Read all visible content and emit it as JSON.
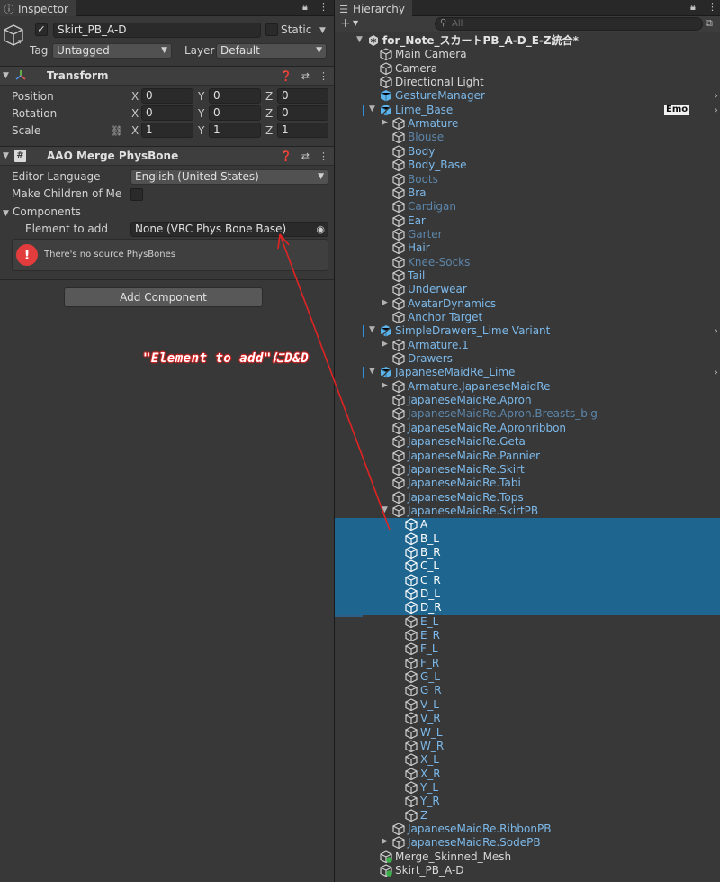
{
  "inspector": {
    "tab_label": "Inspector",
    "object_name": "Skirt_PB_A-D",
    "static_label": "Static",
    "tag_label": "Tag",
    "tag_value": "Untagged",
    "layer_label": "Layer",
    "layer_value": "Default",
    "transform": {
      "title": "Transform",
      "rows": [
        {
          "label": "Position",
          "x": "0",
          "y": "0",
          "z": "0"
        },
        {
          "label": "Rotation",
          "x": "0",
          "y": "0",
          "z": "0"
        },
        {
          "label": "Scale",
          "x": "1",
          "y": "1",
          "z": "1"
        }
      ],
      "axis_x": "X",
      "axis_y": "Y",
      "axis_z": "Z"
    },
    "merge": {
      "title": "AAO Merge PhysBone",
      "editor_language_label": "Editor Language",
      "editor_language_value": "English (United States)",
      "make_children_label": "Make Children of Me",
      "components_label": "Components",
      "element_label": "Element to add",
      "element_value": "None (VRC Phys Bone Base)",
      "error_message": "There's no source PhysBones"
    },
    "add_component": "Add Component"
  },
  "annotation_text": "\"Element to add\"にD&D",
  "hierarchy": {
    "tab_label": "Hierarchy",
    "search_placeholder": "All",
    "emo_badge": "Emo",
    "rows": [
      {
        "label": "for_Note_スカートPB_A-D_E-Z統合*",
        "color": "bold",
        "depth": 0,
        "toggle": "down",
        "icon": "scene"
      },
      {
        "label": "Main Camera",
        "color": "white",
        "depth": 1,
        "toggle": "",
        "icon": "cube"
      },
      {
        "label": "Camera",
        "color": "white",
        "depth": 1,
        "toggle": "",
        "icon": "cube"
      },
      {
        "label": "Directional Light",
        "color": "white",
        "depth": 1,
        "toggle": "",
        "icon": "cube"
      },
      {
        "label": "GestureManager",
        "color": "blue",
        "depth": 1,
        "toggle": "",
        "icon": "prefab",
        "chevron": true
      },
      {
        "label": "Lime_Base",
        "color": "blue",
        "depth": 1,
        "toggle": "down",
        "icon": "prefab-var",
        "chevron": true,
        "mark": true,
        "emo": true
      },
      {
        "label": "Armature",
        "color": "blue",
        "depth": 2,
        "toggle": "right",
        "icon": "cube"
      },
      {
        "label": "Blouse",
        "color": "dim",
        "depth": 2,
        "toggle": "",
        "icon": "cube"
      },
      {
        "label": "Body",
        "color": "blue",
        "depth": 2,
        "toggle": "",
        "icon": "cube"
      },
      {
        "label": "Body_Base",
        "color": "blue",
        "depth": 2,
        "toggle": "",
        "icon": "cube"
      },
      {
        "label": "Boots",
        "color": "dim",
        "depth": 2,
        "toggle": "",
        "icon": "cube"
      },
      {
        "label": "Bra",
        "color": "blue",
        "depth": 2,
        "toggle": "",
        "icon": "cube"
      },
      {
        "label": "Cardigan",
        "color": "dim",
        "depth": 2,
        "toggle": "",
        "icon": "cube"
      },
      {
        "label": "Ear",
        "color": "blue",
        "depth": 2,
        "toggle": "",
        "icon": "cube"
      },
      {
        "label": "Garter",
        "color": "dim",
        "depth": 2,
        "toggle": "",
        "icon": "cube"
      },
      {
        "label": "Hair",
        "color": "blue",
        "depth": 2,
        "toggle": "",
        "icon": "cube"
      },
      {
        "label": "Knee-Socks",
        "color": "dim",
        "depth": 2,
        "toggle": "",
        "icon": "cube"
      },
      {
        "label": "Tail",
        "color": "blue",
        "depth": 2,
        "toggle": "",
        "icon": "cube"
      },
      {
        "label": "Underwear",
        "color": "blue",
        "depth": 2,
        "toggle": "",
        "icon": "cube"
      },
      {
        "label": "AvatarDynamics",
        "color": "blue",
        "depth": 2,
        "toggle": "right",
        "icon": "cube"
      },
      {
        "label": "Anchor Target",
        "color": "blue",
        "depth": 2,
        "toggle": "",
        "icon": "cube"
      },
      {
        "label": "SimpleDrawers_Lime Variant",
        "color": "blue",
        "depth": 1,
        "toggle": "down",
        "icon": "prefab-var",
        "chevron": true,
        "mark": true
      },
      {
        "label": "Armature.1",
        "color": "blue",
        "depth": 2,
        "toggle": "right",
        "icon": "cube"
      },
      {
        "label": "Drawers",
        "color": "blue",
        "depth": 2,
        "toggle": "",
        "icon": "cube"
      },
      {
        "label": "JapaneseMaidRe_Lime",
        "color": "blue",
        "depth": 1,
        "toggle": "down",
        "icon": "prefab-var",
        "chevron": true,
        "mark": true
      },
      {
        "label": "Armature.JapaneseMaidRe",
        "color": "blue",
        "depth": 2,
        "toggle": "right",
        "icon": "cube"
      },
      {
        "label": "JapaneseMaidRe.Apron",
        "color": "blue",
        "depth": 2,
        "toggle": "",
        "icon": "cube"
      },
      {
        "label": "JapaneseMaidRe.Apron.Breasts_big",
        "color": "dim",
        "depth": 2,
        "toggle": "",
        "icon": "cube"
      },
      {
        "label": "JapaneseMaidRe.Apronribbon",
        "color": "blue",
        "depth": 2,
        "toggle": "",
        "icon": "cube"
      },
      {
        "label": "JapaneseMaidRe.Geta",
        "color": "blue",
        "depth": 2,
        "toggle": "",
        "icon": "cube"
      },
      {
        "label": "JapaneseMaidRe.Pannier",
        "color": "blue",
        "depth": 2,
        "toggle": "",
        "icon": "cube"
      },
      {
        "label": "JapaneseMaidRe.Skirt",
        "color": "blue",
        "depth": 2,
        "toggle": "",
        "icon": "cube"
      },
      {
        "label": "JapaneseMaidRe.Tabi",
        "color": "blue",
        "depth": 2,
        "toggle": "",
        "icon": "cube"
      },
      {
        "label": "JapaneseMaidRe.Tops",
        "color": "blue",
        "depth": 2,
        "toggle": "",
        "icon": "cube"
      },
      {
        "label": "JapaneseMaidRe.SkirtPB",
        "color": "blue",
        "depth": 2,
        "toggle": "down",
        "icon": "cube"
      },
      {
        "label": "A",
        "color": "sel",
        "depth": 3,
        "toggle": "",
        "icon": "cube",
        "selected": true
      },
      {
        "label": "B_L",
        "color": "sel",
        "depth": 3,
        "toggle": "",
        "icon": "cube",
        "selected": true
      },
      {
        "label": "B_R",
        "color": "sel",
        "depth": 3,
        "toggle": "",
        "icon": "cube",
        "selected": true
      },
      {
        "label": "C_L",
        "color": "sel",
        "depth": 3,
        "toggle": "",
        "icon": "cube",
        "selected": true
      },
      {
        "label": "C_R",
        "color": "sel",
        "depth": 3,
        "toggle": "",
        "icon": "cube",
        "selected": true
      },
      {
        "label": "D_L",
        "color": "sel",
        "depth": 3,
        "toggle": "",
        "icon": "cube",
        "selected": true
      },
      {
        "label": "D_R",
        "color": "sel",
        "depth": 3,
        "toggle": "",
        "icon": "cube",
        "selected": true
      },
      {
        "label": "E_L",
        "color": "blue",
        "depth": 3,
        "toggle": "",
        "icon": "cube"
      },
      {
        "label": "E_R",
        "color": "blue",
        "depth": 3,
        "toggle": "",
        "icon": "cube"
      },
      {
        "label": "F_L",
        "color": "blue",
        "depth": 3,
        "toggle": "",
        "icon": "cube"
      },
      {
        "label": "F_R",
        "color": "blue",
        "depth": 3,
        "toggle": "",
        "icon": "cube"
      },
      {
        "label": "G_L",
        "color": "blue",
        "depth": 3,
        "toggle": "",
        "icon": "cube"
      },
      {
        "label": "G_R",
        "color": "blue",
        "depth": 3,
        "toggle": "",
        "icon": "cube"
      },
      {
        "label": "V_L",
        "color": "blue",
        "depth": 3,
        "toggle": "",
        "icon": "cube"
      },
      {
        "label": "V_R",
        "color": "blue",
        "depth": 3,
        "toggle": "",
        "icon": "cube"
      },
      {
        "label": "W_L",
        "color": "blue",
        "depth": 3,
        "toggle": "",
        "icon": "cube"
      },
      {
        "label": "W_R",
        "color": "blue",
        "depth": 3,
        "toggle": "",
        "icon": "cube"
      },
      {
        "label": "X_L",
        "color": "blue",
        "depth": 3,
        "toggle": "",
        "icon": "cube"
      },
      {
        "label": "X_R",
        "color": "blue",
        "depth": 3,
        "toggle": "",
        "icon": "cube"
      },
      {
        "label": "Y_L",
        "color": "blue",
        "depth": 3,
        "toggle": "",
        "icon": "cube"
      },
      {
        "label": "Y_R",
        "color": "blue",
        "depth": 3,
        "toggle": "",
        "icon": "cube"
      },
      {
        "label": "Z",
        "color": "blue",
        "depth": 3,
        "toggle": "",
        "icon": "cube"
      },
      {
        "label": "JapaneseMaidRe.RibbonPB",
        "color": "blue",
        "depth": 2,
        "toggle": "",
        "icon": "cube"
      },
      {
        "label": "JapaneseMaidRe.SodePB",
        "color": "blue",
        "depth": 2,
        "toggle": "right",
        "icon": "cube"
      },
      {
        "label": "Merge_Skinned_Mesh",
        "color": "white",
        "depth": 1,
        "toggle": "",
        "icon": "gameobj-green"
      },
      {
        "label": "Skirt_PB_A-D",
        "color": "white",
        "depth": 1,
        "toggle": "",
        "icon": "gameobj-green"
      }
    ]
  },
  "colors": {
    "selection": "#1e6690",
    "annotation_red": "#e02424",
    "link_blue": "#7cb9ea"
  }
}
